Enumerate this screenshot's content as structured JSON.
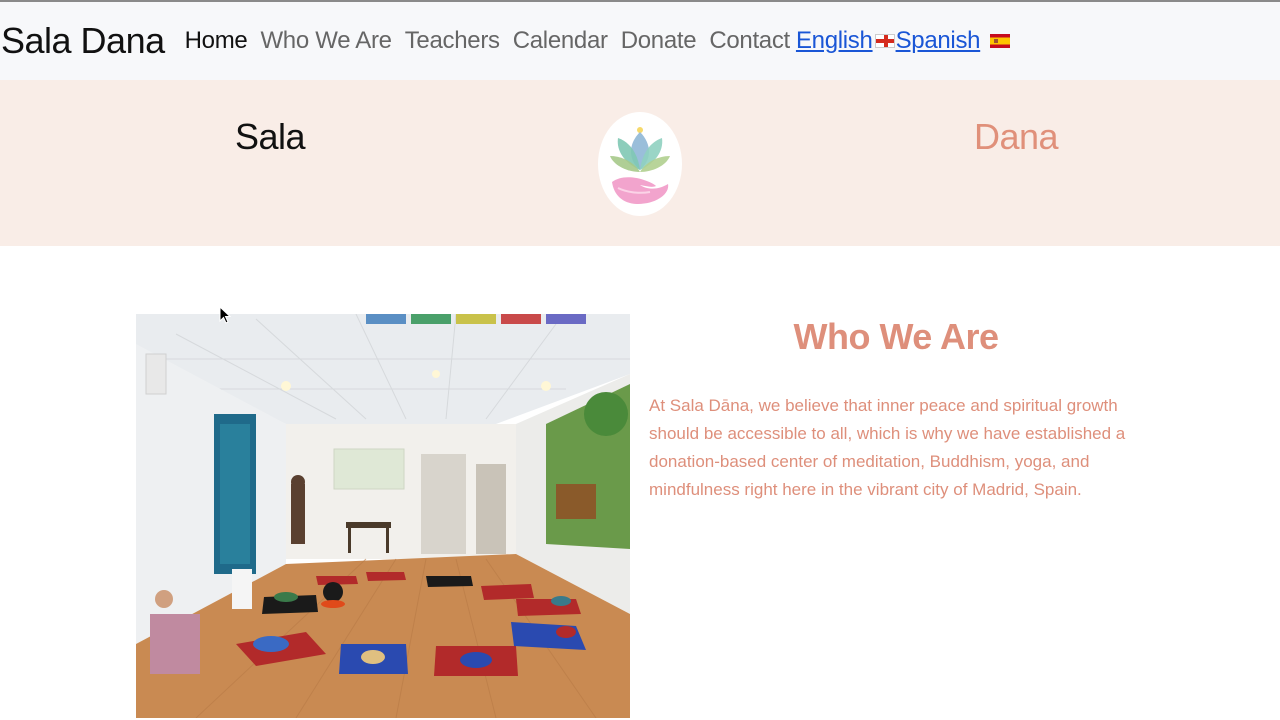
{
  "navbar": {
    "brand": "Sala Dana",
    "links": [
      "Home",
      "Who We Are",
      "Teachers",
      "Calendar",
      "Donate",
      "Contact"
    ],
    "active": "Home",
    "languages": [
      {
        "label": "English",
        "flag": "uk-flag-icon"
      },
      {
        "label": "Spanish",
        "flag": "spain-flag-icon"
      }
    ]
  },
  "hero": {
    "left_word": "Sala",
    "right_word": "Dana",
    "logo": "lotus-hand-logo"
  },
  "about": {
    "title": "Who We Are",
    "text": "At Sala Dāna, we believe that inner peace and spiritual growth should be accessible to all, which is why we have established a donation-based center of meditation, Buddhism, yoga, and mindfulness right here in the vibrant city of Madrid, Spain.",
    "photo": "meditation-room-photo"
  },
  "colors": {
    "accent": "#de8f7b",
    "hero_bg": "#f9ede7",
    "navbar_bg": "#f7f8fa",
    "link": "#1a56d6"
  }
}
